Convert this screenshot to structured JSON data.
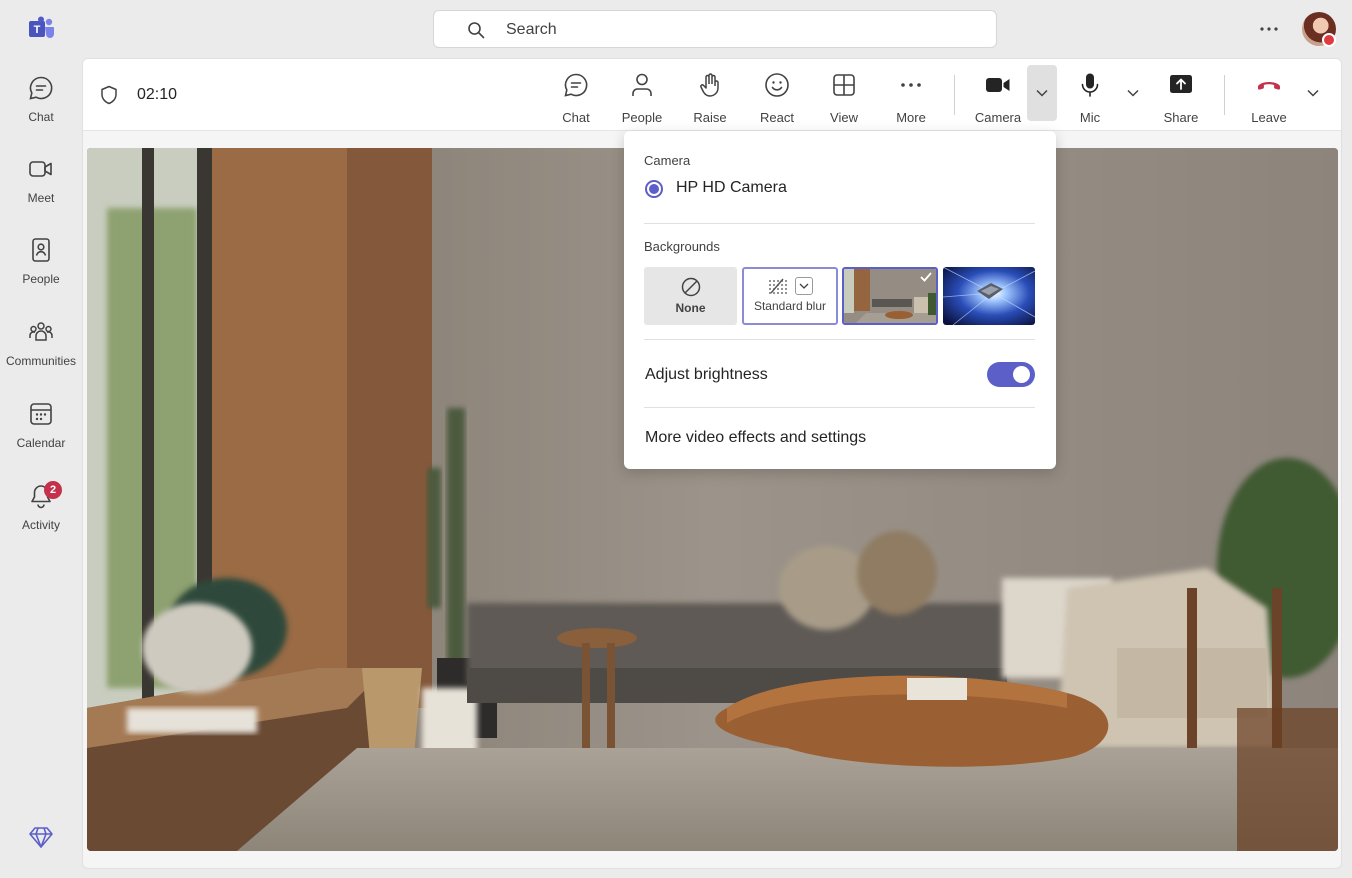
{
  "rail": {
    "items": [
      {
        "label": "Chat",
        "icon": "chat-icon"
      },
      {
        "label": "Meet",
        "icon": "video-camera-icon"
      },
      {
        "label": "People",
        "icon": "contact-book-icon"
      },
      {
        "label": "Communities",
        "icon": "communities-icon"
      },
      {
        "label": "Calendar",
        "icon": "calendar-icon"
      },
      {
        "label": "Activity",
        "icon": "bell-icon",
        "badge": "2"
      }
    ]
  },
  "search": {
    "placeholder": "Search"
  },
  "meeting": {
    "timer": "02:10",
    "toolbar": {
      "chat": "Chat",
      "people": "People",
      "raise": "Raise",
      "react": "React",
      "view": "View",
      "more": "More",
      "camera": "Camera",
      "mic": "Mic",
      "share": "Share",
      "leave": "Leave"
    }
  },
  "flyout": {
    "camera_heading": "Camera",
    "camera_name": "HP HD Camera",
    "backgrounds_heading": "Backgrounds",
    "bg_none": "None",
    "bg_blur": "Standard blur",
    "adjust_brightness": "Adjust brightness",
    "adjust_brightness_on": true,
    "more_effects": "More video effects and settings"
  },
  "colors": {
    "accent": "#5b5fc7",
    "leave_red": "#c4314b",
    "badge": "#c4314b"
  }
}
